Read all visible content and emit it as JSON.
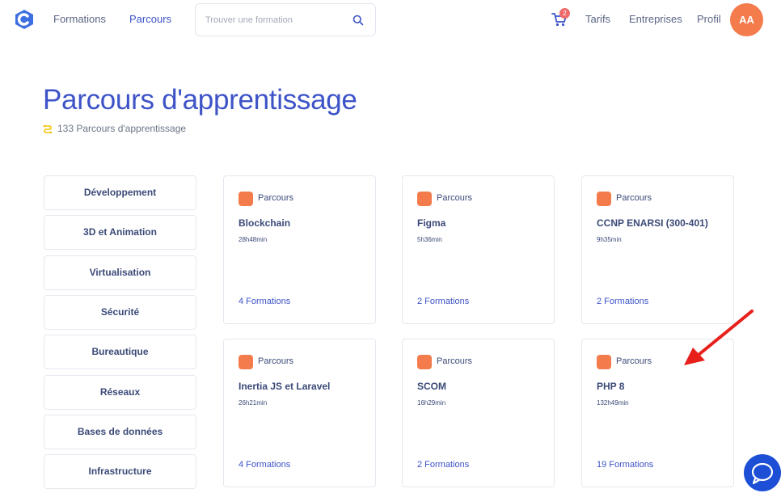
{
  "header": {
    "nav": [
      {
        "label": "Formations",
        "active": false
      },
      {
        "label": "Parcours",
        "active": true
      }
    ],
    "search": {
      "placeholder": "Trouver une formation",
      "value": ""
    },
    "cart_count": "2",
    "right_nav": [
      "Tarifs",
      "Entreprises",
      "Profil"
    ],
    "avatar_initials": "AA"
  },
  "page": {
    "title": "Parcours d'apprentissage",
    "subtitle": "133 Parcours d'apprentissage"
  },
  "categories": [
    "Développement",
    "3D et Animation",
    "Virtualisation",
    "Sécurité",
    "Bureautique",
    "Réseaux",
    "Bases de données",
    "Infrastructure"
  ],
  "cards": [
    {
      "badge": "Parcours",
      "title": "Blockchain",
      "duration": "28h48min",
      "count": "4 Formations"
    },
    {
      "badge": "Parcours",
      "title": "Figma",
      "duration": "5h36min",
      "count": "2 Formations"
    },
    {
      "badge": "Parcours",
      "title": "CCNP ENARSI (300-401)",
      "duration": "9h35min",
      "count": "2 Formations"
    },
    {
      "badge": "Parcours",
      "title": "Inertia JS et Laravel",
      "duration": "26h21min",
      "count": "4 Formations"
    },
    {
      "badge": "Parcours",
      "title": "SCOM",
      "duration": "16h29min",
      "count": "2 Formations"
    },
    {
      "badge": "Parcours",
      "title": "PHP 8",
      "duration": "132h49min",
      "count": "19 Formations"
    }
  ],
  "colors": {
    "brand_blue": "#3d53c7",
    "accent_orange": "#f47c4c",
    "badge_red": "#f06a6a",
    "annotation_arrow": "#e8201c",
    "chat_blue": "#1c4fd6"
  },
  "icons": [
    "logo-icon",
    "search-icon",
    "cart-icon",
    "path-icon",
    "chat-icon",
    "arrow-annotation"
  ]
}
